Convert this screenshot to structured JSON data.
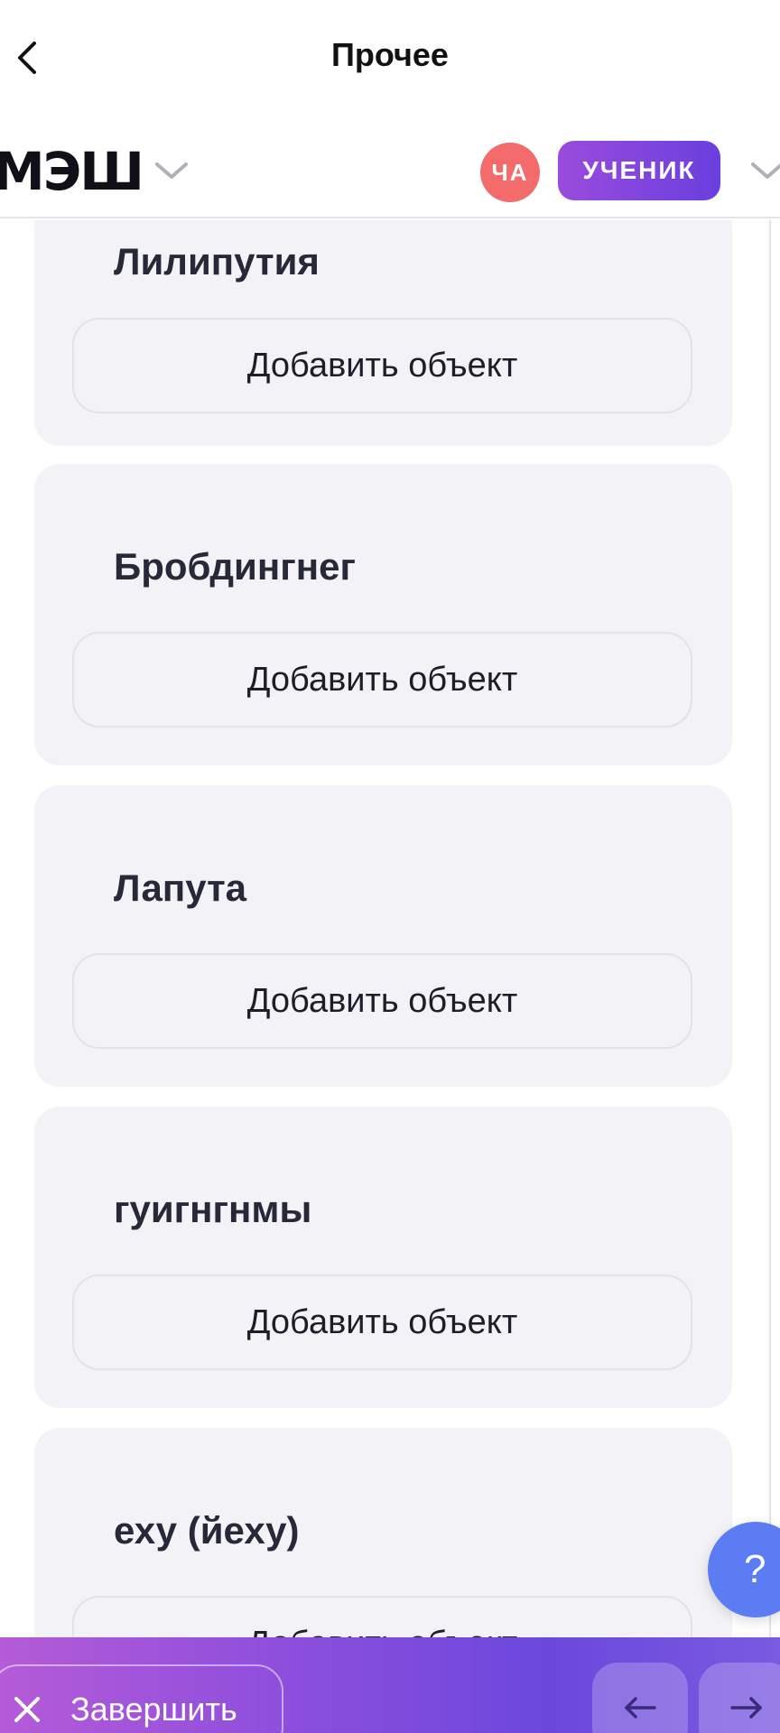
{
  "nav": {
    "title": "Прочее"
  },
  "header": {
    "logo": "МЭШ",
    "avatar_initials": "ЧА",
    "role": "УЧЕНИК"
  },
  "cards": [
    {
      "title": "Лилипутия",
      "button": "Добавить объект"
    },
    {
      "title": "Бробдингнег",
      "button": "Добавить объект"
    },
    {
      "title": "Лапута",
      "button": "Добавить объект"
    },
    {
      "title": "гуигнгнмы",
      "button": "Добавить объект"
    },
    {
      "title": "еху (йеху)",
      "button": "Добавить объект"
    }
  ],
  "help": {
    "label": "?"
  },
  "bottom": {
    "finish_label": "Завершить",
    "prev_icon": "arrow-left-icon",
    "next_icon": "arrow-right-icon"
  },
  "colors": {
    "accent_purple": "#7a4fe0",
    "avatar_red": "#f46b6b",
    "help_blue": "#5b7cf2",
    "card_bg": "#f3f3f7"
  }
}
